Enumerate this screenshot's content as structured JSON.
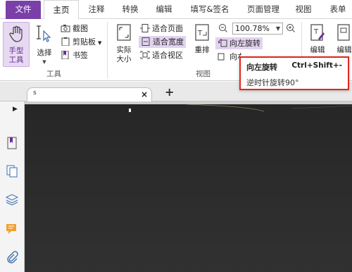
{
  "menu": {
    "tabs": [
      {
        "label": "文件"
      },
      {
        "label": "主页"
      },
      {
        "label": "注释"
      },
      {
        "label": "转换"
      },
      {
        "label": "编辑"
      },
      {
        "label": "填写&签名"
      },
      {
        "label": "页面管理"
      },
      {
        "label": "视图"
      },
      {
        "label": "表单"
      }
    ]
  },
  "ribbon": {
    "hand_tool": {
      "line1": "手型",
      "line2": "工具"
    },
    "select_tool": {
      "label": "选择"
    },
    "tools_small": [
      {
        "label": "截图"
      },
      {
        "label": "剪贴板"
      },
      {
        "label": "书签"
      }
    ],
    "tools_group_label": "工具",
    "actual_size": {
      "line1": "实际",
      "line2": "大小"
    },
    "fit": [
      {
        "label": "适合页面"
      },
      {
        "label": "适合宽度"
      },
      {
        "label": "适合视区"
      }
    ],
    "reflow": {
      "label": "重排"
    },
    "zoom": {
      "value": "100.78%"
    },
    "rotate_left": {
      "label": "向左旋转"
    },
    "rotate_right_partial": {
      "label": "向右旋转"
    },
    "view_group_label": "视图",
    "edit1": {
      "label": "编辑"
    },
    "edit2": {
      "label": "编辑"
    }
  },
  "tooltip": {
    "title": "向左旋转",
    "shortcut": "Ctrl+Shift+-",
    "description": "逆时针旋转90°"
  },
  "doc_tab": {
    "title": "s"
  },
  "colors": {
    "accent": "#7a3fa8",
    "tooltip_border": "#e0261e",
    "page_bg": "#2a2a2a"
  }
}
